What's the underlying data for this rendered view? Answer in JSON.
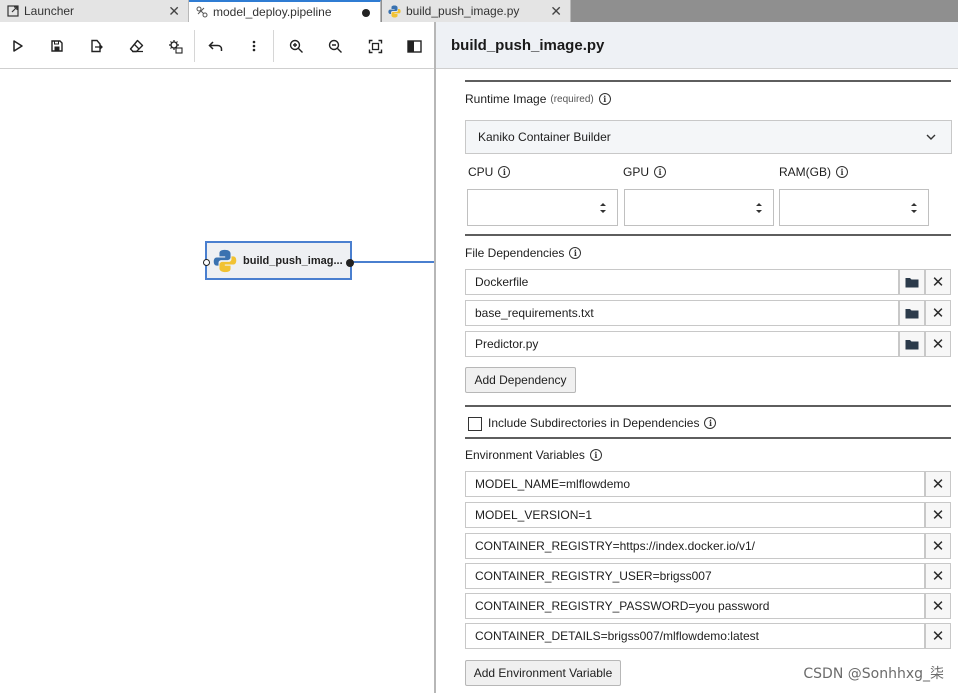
{
  "tabs": [
    {
      "label": "Launcher",
      "icon": "launcher-icon",
      "close": "✕"
    },
    {
      "label": "model_deploy.pipeline",
      "icon": "pipeline-icon"
    },
    {
      "label": "build_push_image.py",
      "icon": "python-icon",
      "close": "✕"
    }
  ],
  "toolbar": {
    "buttons": [
      "run-icon",
      "save-icon",
      "export-icon",
      "clear-icon",
      "runtimes-icon",
      "undo-icon",
      "more-icon",
      "zoom-in-icon",
      "zoom-out-icon",
      "fit-icon",
      "toggle-panel-icon"
    ]
  },
  "canvas": {
    "node": {
      "label": "build_push_imag..."
    }
  },
  "panel": {
    "title": "build_push_image.py",
    "runtime_image_label": "Runtime Image",
    "runtime_image_required": "(required)",
    "runtime_image_value": "Kaniko Container Builder",
    "cpu_label": "CPU",
    "gpu_label": "GPU",
    "ram_label": "RAM(GB)",
    "file_dependencies_label": "File Dependencies",
    "dependencies": [
      "Dockerfile",
      "base_requirements.txt",
      "Predictor.py"
    ],
    "add_dependency": "Add Dependency",
    "include_subdirs": "Include Subdirectories in Dependencies",
    "env_vars_label": "Environment Variables",
    "env_vars": [
      "MODEL_NAME=mlflowdemo",
      "MODEL_VERSION=1",
      "CONTAINER_REGISTRY=https://index.docker.io/v1/",
      "CONTAINER_REGISTRY_USER=brigss007",
      "CONTAINER_REGISTRY_PASSWORD=you password",
      "CONTAINER_DETAILS=brigss007/mlflowdemo:latest"
    ],
    "add_env_var": "Add Environment Variable",
    "remove_glyph": "✕"
  },
  "watermark": "CSDN @Sonhhxg_柒"
}
